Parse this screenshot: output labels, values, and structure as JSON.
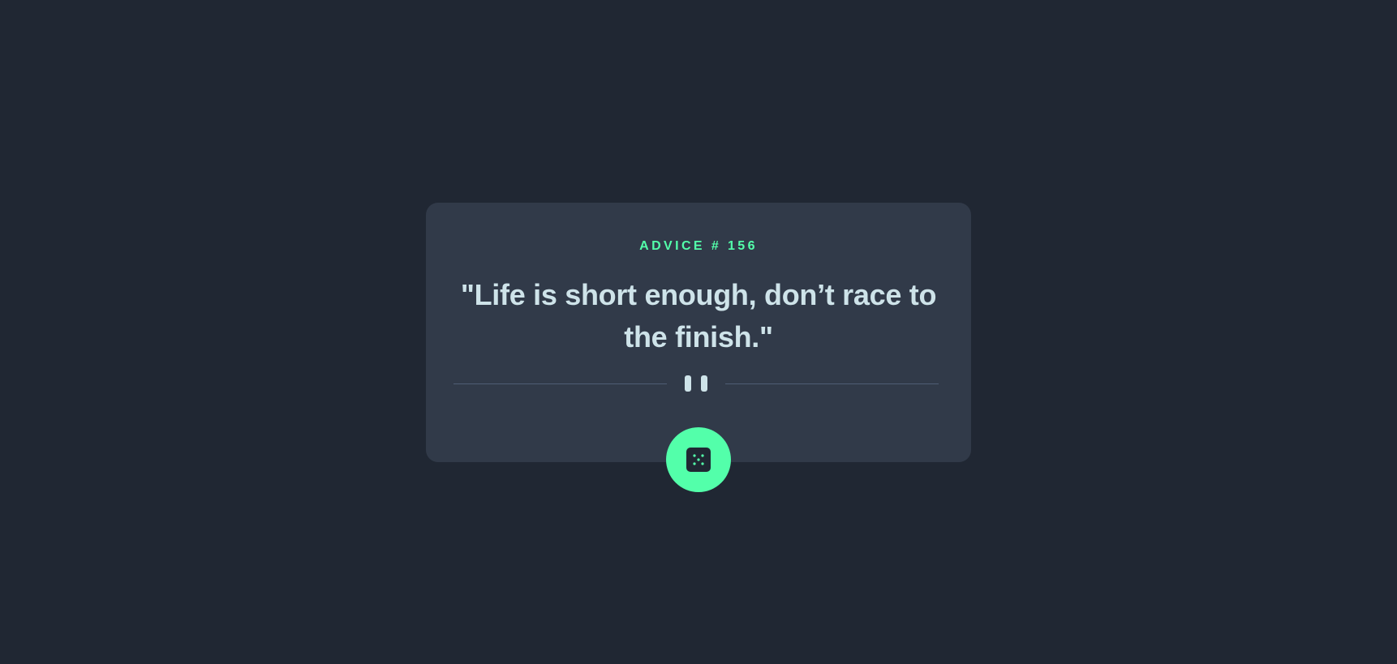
{
  "advice": {
    "label": "ADVICE # 156",
    "text": "\"Life is short enough, don’t race to the finish.\""
  },
  "divider": {
    "icon": "pause-icon"
  },
  "button": {
    "icon": "dice-icon",
    "aria_label": "Generate new advice"
  },
  "colors": {
    "background": "#202733",
    "card": "#313A49",
    "accent": "#53FFAA",
    "text": "#CEE3E9",
    "divider_line": "#4F5D74"
  }
}
